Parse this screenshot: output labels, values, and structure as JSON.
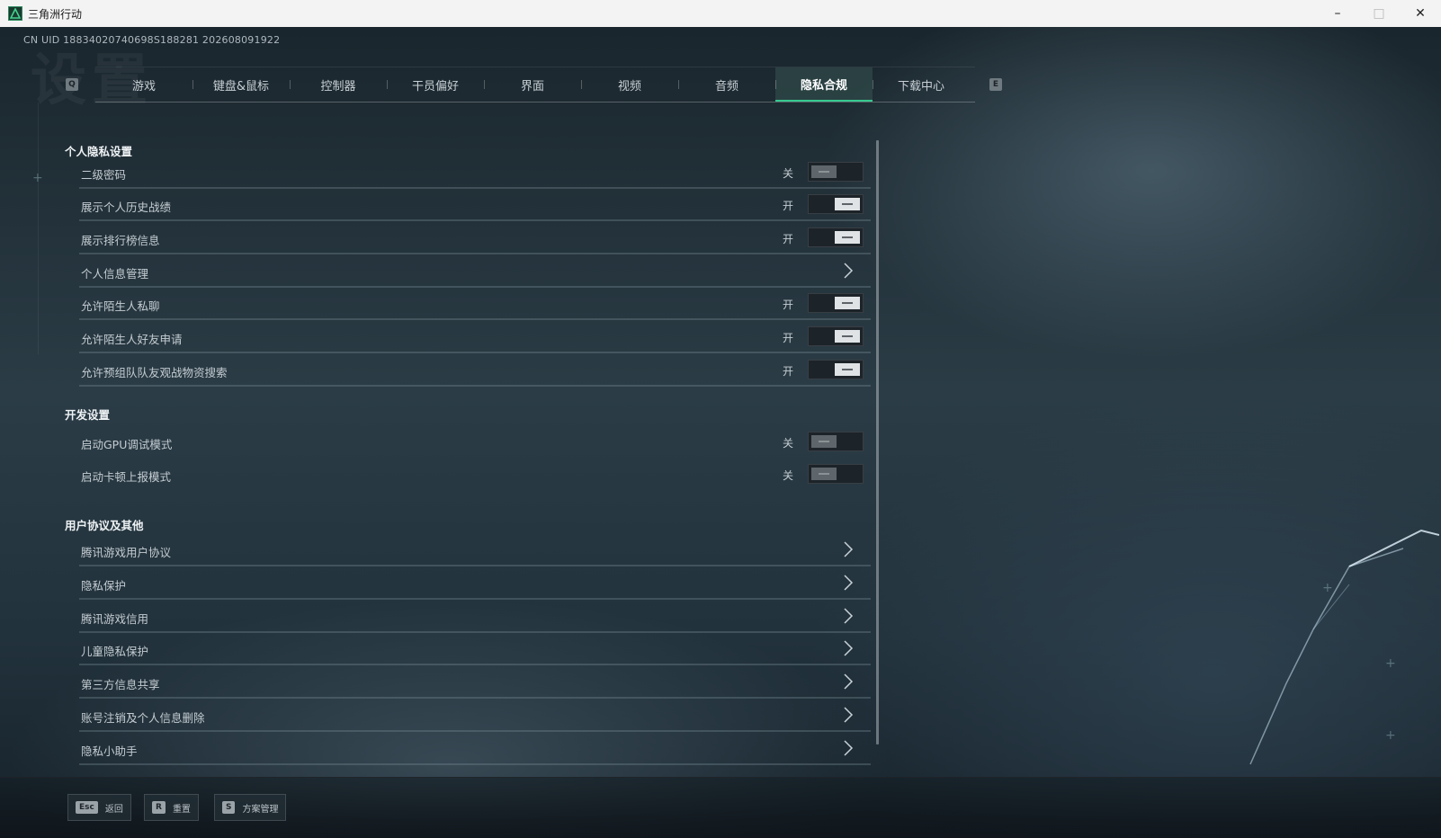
{
  "window": {
    "title": "三角洲行动",
    "minimize": "–",
    "maximize": "□",
    "close": "✕"
  },
  "header": {
    "uid": "CN UID 18834020740698S188281 202608091922",
    "bg_title": "设置",
    "prev_key": "Q",
    "next_key": "E"
  },
  "tabs": [
    {
      "label": "游戏"
    },
    {
      "label": "键盘&鼠标"
    },
    {
      "label": "控制器"
    },
    {
      "label": "干员偏好"
    },
    {
      "label": "界面"
    },
    {
      "label": "视频"
    },
    {
      "label": "音频"
    },
    {
      "label": "隐私合规",
      "active": true
    },
    {
      "label": "下载中心"
    }
  ],
  "sections": {
    "privacy": {
      "title": "个人隐私设置",
      "rows": [
        {
          "label": "二级密码",
          "state": "关"
        },
        {
          "label": "展示个人历史战绩",
          "state": "开"
        },
        {
          "label": "展示排行榜信息",
          "state": "开"
        },
        {
          "label": "个人信息管理"
        },
        {
          "label": "允许陌生人私聊",
          "state": "开"
        },
        {
          "label": "允许陌生人好友申请",
          "state": "开"
        },
        {
          "label": "允许预组队队友观战物资搜索",
          "state": "开"
        }
      ]
    },
    "dev": {
      "title": "开发设置",
      "rows": [
        {
          "label": "启动GPU调试模式",
          "state": "关"
        },
        {
          "label": "启动卡顿上报模式",
          "state": "关"
        }
      ]
    },
    "agreements": {
      "title": "用户协议及其他",
      "rows": [
        {
          "label": "腾讯游戏用户协议"
        },
        {
          "label": "隐私保护"
        },
        {
          "label": "腾讯游戏信用"
        },
        {
          "label": "儿童隐私保护"
        },
        {
          "label": "第三方信息共享"
        },
        {
          "label": "账号注销及个人信息删除"
        },
        {
          "label": "隐私小助手"
        }
      ]
    }
  },
  "bottom": {
    "back": {
      "key": "Esc",
      "label": "返回"
    },
    "reset": {
      "key": "R",
      "label": "重置"
    },
    "scheme": {
      "key": "S",
      "label": "方案管理"
    }
  },
  "colors": {
    "accent": "#35c98f",
    "toggle_on_knob": "#dfe3e5",
    "toggle_off_knob": "#5e666b"
  }
}
